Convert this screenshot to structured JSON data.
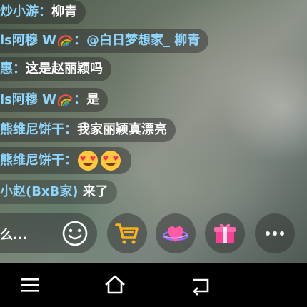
{
  "chat": {
    "messages": [
      {
        "name": "炒小游：",
        "text": "柳青"
      },
      {
        "name": "ls阿穆 W",
        "badge": "rainbow-icon",
        "sep": "：",
        "text": "@白日梦想家_ 柳青"
      },
      {
        "name": "惠：",
        "text": "这是赵丽颖吗"
      },
      {
        "name": "ls阿穆 W",
        "badge": "rainbow-icon",
        "sep": "：",
        "text": "是"
      },
      {
        "name": "熊维尼饼干：",
        "text": "我家丽颖真漂亮"
      },
      {
        "name": "熊维尼饼干：",
        "emojis": [
          "heart-eyes-emoji",
          "heart-eyes-emoji"
        ]
      },
      {
        "name": "小赵(BxB家)",
        "text": " 来了"
      }
    ]
  },
  "input": {
    "placeholder": "么..."
  },
  "actions": {
    "emoji": "smile-icon",
    "cart": "shopping-cart-icon",
    "like": "planet-heart-icon",
    "gift": "gift-icon",
    "more": "more-icon"
  },
  "nav": {
    "menu": "menu-icon",
    "home": "home-icon",
    "back": "back-icon"
  },
  "colors": {
    "name": "#8fd6ff",
    "text": "#ffffff",
    "cart": "#ffb21a",
    "like": "#ff5aa5",
    "gift": "#ff3f93"
  }
}
